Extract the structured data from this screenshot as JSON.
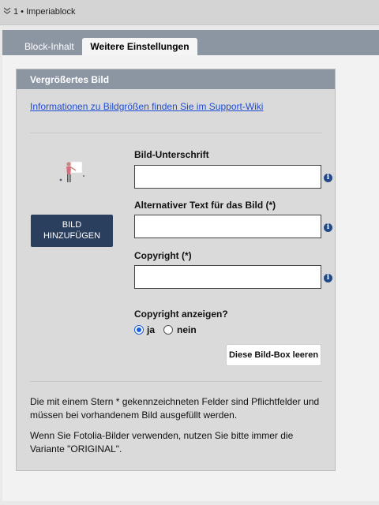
{
  "header": {
    "title": "1 • Imperiablock"
  },
  "tabs": [
    {
      "label": "Block-Inhalt",
      "active": false
    },
    {
      "label": "Weitere Einstellungen",
      "active": true
    }
  ],
  "card": {
    "title": "Vergrößertes Bild",
    "wiki_link": "Informationen zu Bildgrößen finden Sie im Support-Wiki",
    "add_image_line1": "BILD",
    "add_image_line2": "HINZUFÜGEN",
    "fields": [
      {
        "label": "Bild-Unterschrift",
        "value": "",
        "placeholder": ""
      },
      {
        "label": "Alternativer Text für das Bild (*)",
        "value": "",
        "placeholder": ""
      },
      {
        "label": "Copyright (*)",
        "value": "",
        "placeholder": ""
      }
    ],
    "copyright_question": "Copyright anzeigen?",
    "radio_yes": "ja",
    "radio_no": "nein",
    "selected": "ja",
    "clear_button": "Diese Bild-Box leeren",
    "note1": "Die mit einem Stern * gekennzeichneten Felder sind Pflichtfelder und müssen bei vorhandenem Bild ausgefüllt werden.",
    "note2": "Wenn Sie Fotolia-Bilder verwenden, nutzen Sie bitte immer die Variante \"ORIGINAL\"."
  },
  "colors": {
    "tab_bar": "#8c96a3",
    "button_dark": "#2a3e5e",
    "link": "#1f4dd6",
    "radio_selected": "#1a5ee0"
  },
  "icons": {
    "collapse": "chevron-double-down-icon",
    "info": "info-icon",
    "thumbnail": "image-placeholder-icon"
  }
}
